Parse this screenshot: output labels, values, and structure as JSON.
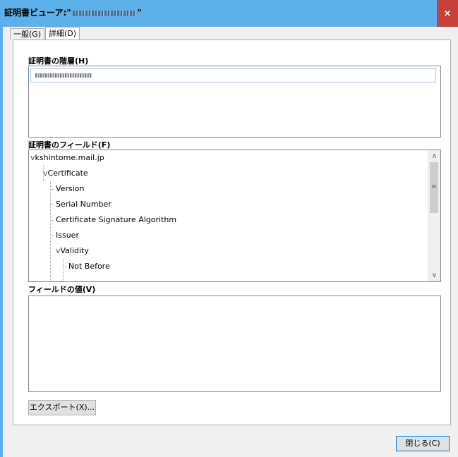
{
  "window": {
    "title_prefix": "証明書ビューア:\"",
    "title_suffix": "\"",
    "close_glyph": "×"
  },
  "tabs": [
    {
      "label": "一般(G)"
    },
    {
      "label": "詳細(D)",
      "active": true
    }
  ],
  "hierarchy": {
    "label": "証明書の階層(H)"
  },
  "fields": {
    "label": "証明書のフィールド(F)",
    "items": [
      {
        "label": "kshintome.mail.jp",
        "expander": "v"
      },
      {
        "label": "Certificate",
        "expander": "v"
      },
      {
        "label": "Version"
      },
      {
        "label": "Serial Number"
      },
      {
        "label": "Certificate Signature Algorithm"
      },
      {
        "label": "Issuer"
      },
      {
        "label": "Validity",
        "expander": "v"
      },
      {
        "label": "Not Before"
      }
    ]
  },
  "value": {
    "label": "フィールドの値(V)"
  },
  "buttons": {
    "export": "エクスポート(X)...",
    "close": "閉じる(C)"
  },
  "colors": {
    "titlebar": "#5eb0ea",
    "close_button": "#c7403a",
    "selection_border": "#99d1ff"
  }
}
